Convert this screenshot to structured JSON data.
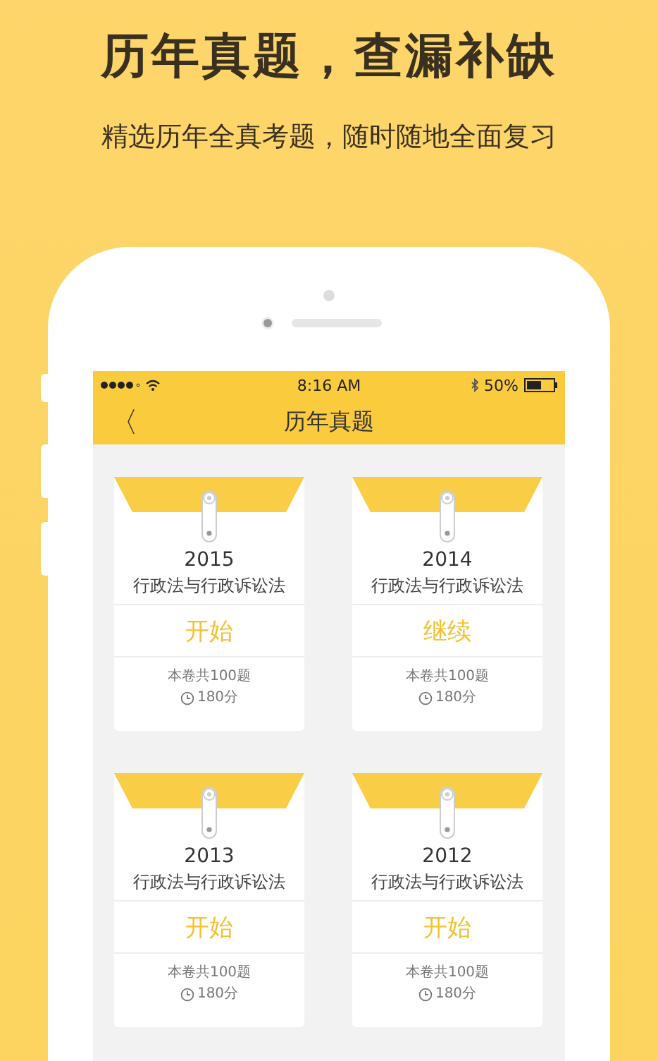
{
  "headline": "历年真题，查漏补缺",
  "subtitle": "精选历年全真考题，随时随地全面复习",
  "status_bar": {
    "time": "8:16 AM",
    "battery": "50%"
  },
  "nav": {
    "back": "〈",
    "title": "历年真题"
  },
  "papers": [
    {
      "year": "2015",
      "subject": "行政法与行政诉讼法",
      "action": "开始",
      "count": "本卷共100题",
      "duration": "180分"
    },
    {
      "year": "2014",
      "subject": "行政法与行政诉讼法",
      "action": "继续",
      "count": "本卷共100题",
      "duration": "180分"
    },
    {
      "year": "2013",
      "subject": "行政法与行政诉讼法",
      "action": "开始",
      "count": "本卷共100题",
      "duration": "180分"
    },
    {
      "year": "2012",
      "subject": "行政法与行政诉讼法",
      "action": "开始",
      "count": "本卷共100题",
      "duration": "180分"
    }
  ]
}
